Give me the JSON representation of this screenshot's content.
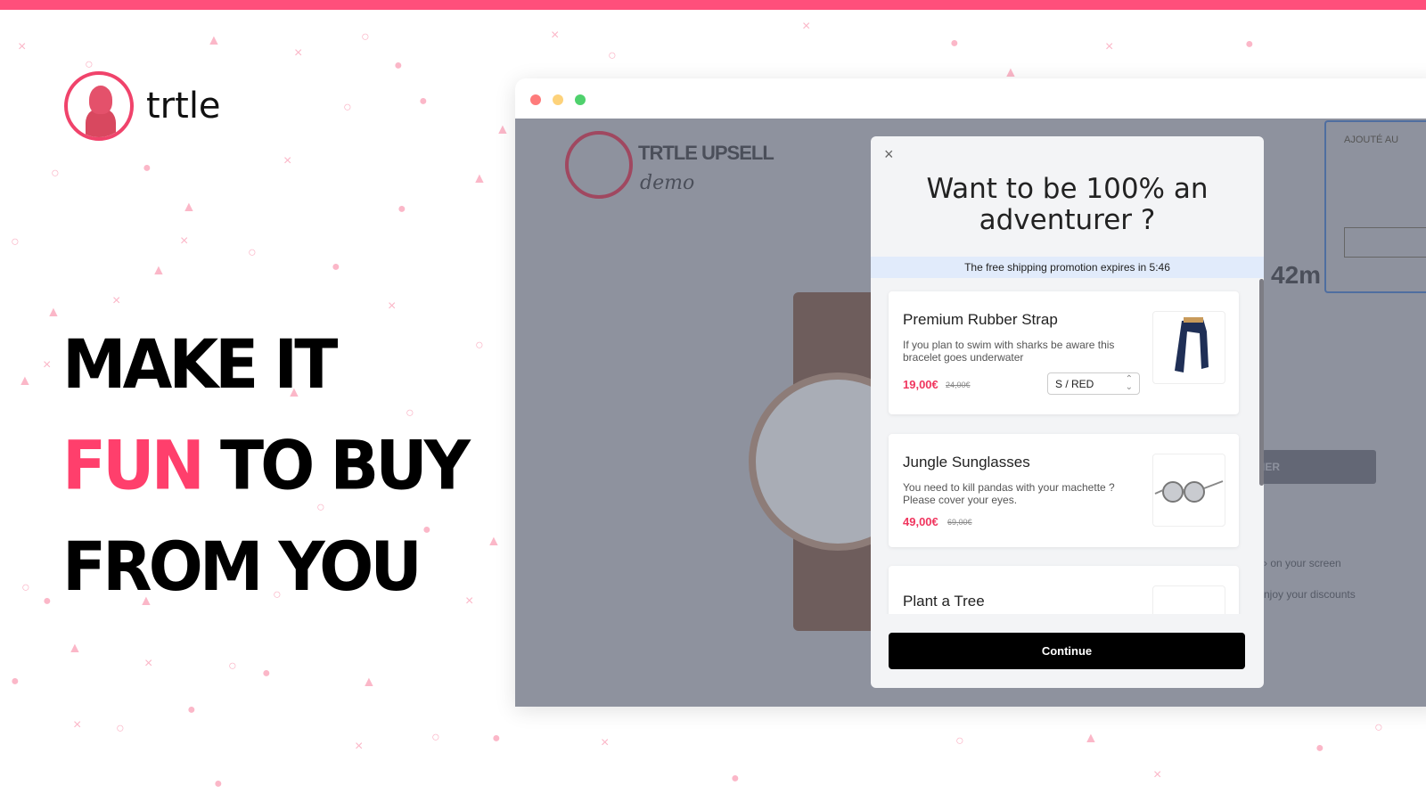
{
  "brand": {
    "name": "trtle",
    "accent": "#ff4f7b"
  },
  "headline": {
    "line1": "MAKE IT",
    "line2_highlight": "FUN",
    "line2_rest": " TO BUY",
    "line3": "FROM YOU"
  },
  "window": {
    "dots": [
      "#fe5f57",
      "#febc2e",
      "#28c840"
    ]
  },
  "shop": {
    "title": "TRTLE UPSELL",
    "subtitle": "demo",
    "cart_panel_label": "AJOUTÉ AU",
    "size_text": "42m",
    "button_partial": "IER",
    "hint1": "› on your screen",
    "hint2": "njoy your discounts"
  },
  "modal": {
    "close": "×",
    "title": "Want to be 100% an adventurer ?",
    "promo": "The free shipping promotion expires in 5:46",
    "products": [
      {
        "name": "Premium Rubber Strap",
        "description": "If you plan to swim with sharks be aware this bracelet goes underwater",
        "price": "19,00€",
        "old_price": "24,00€",
        "variant": "S / RED"
      },
      {
        "name": "Jungle Sunglasses",
        "description": "You need to kill pandas with your machette ? Please cover your eyes.",
        "price": "49,00€",
        "old_price": "69,00€"
      },
      {
        "name": "Plant a Tree"
      }
    ],
    "continue_label": "Continue"
  }
}
